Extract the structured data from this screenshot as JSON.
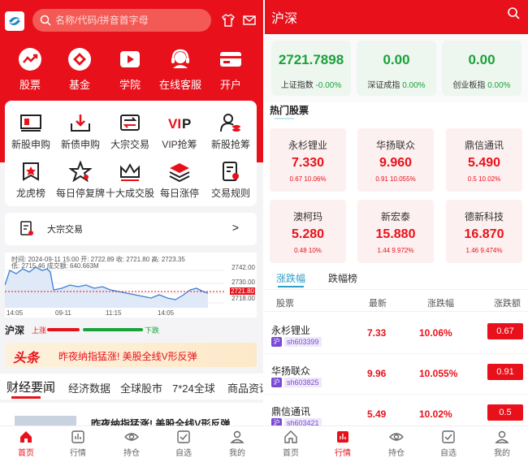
{
  "left": {
    "search": {
      "placeholder": "名称/代码/拼音首字母"
    },
    "quick": [
      {
        "label": "股票",
        "icon": "trend-icon"
      },
      {
        "label": "基金",
        "icon": "fund-icon"
      },
      {
        "label": "学院",
        "icon": "video-icon"
      },
      {
        "label": "在线客服",
        "icon": "headset-icon"
      },
      {
        "label": "开户",
        "icon": "card-icon"
      }
    ],
    "grid": [
      {
        "label": "新股申购",
        "icon": "ipo-icon"
      },
      {
        "label": "新债申购",
        "icon": "download-icon"
      },
      {
        "label": "大宗交易",
        "icon": "block-trade-icon"
      },
      {
        "label": "VIP抢筹",
        "icon": "vip-icon"
      },
      {
        "label": "新股抢筹",
        "icon": "user-coins-icon"
      },
      {
        "label": "龙虎榜",
        "icon": "badge-icon"
      },
      {
        "label": "每日停复牌",
        "icon": "star-icon"
      },
      {
        "label": "十大成交股",
        "icon": "crown-icon"
      },
      {
        "label": "每日涨停",
        "icon": "layers-icon"
      },
      {
        "label": "交易规则",
        "icon": "rules-icon"
      }
    ],
    "block_trade": {
      "label": "大宗交易",
      "arrow": ">"
    },
    "mini_chart": {
      "info": "时间: 2024-09-11 15:00   开: 2722.89   收: 2721.80   高: 2723.35",
      "info2": "低: 2715.46   成交额: 640.663M",
      "yticks": [
        "2742.00",
        "2730.00",
        "2721.80",
        "2718.00"
      ],
      "xticks": [
        "14:05",
        "09-11",
        "11:15",
        "14:05"
      ],
      "last": "2721.80"
    },
    "market": {
      "title": "沪深",
      "up": "上涨",
      "down": "下跌"
    },
    "banner": {
      "brand": "头条",
      "text": "昨夜纳指猛涨! 美股全线V形反弹"
    },
    "news_tabs": [
      "财经要闻",
      "经济数据",
      "全球股市",
      "7*24全球",
      "商品资讯"
    ],
    "news": {
      "title": "昨夜纳指猛涨! 美股全线V形反弹"
    },
    "nav": [
      {
        "label": "首页",
        "icon": "home-icon"
      },
      {
        "label": "行情",
        "icon": "market-icon"
      },
      {
        "label": "持仓",
        "icon": "position-icon"
      },
      {
        "label": "自选",
        "icon": "watchlist-icon"
      },
      {
        "label": "我的",
        "icon": "profile-icon"
      }
    ]
  },
  "right": {
    "title": "沪深",
    "indices": [
      {
        "value": "2721.7898",
        "name": "上证指数",
        "change": "-0.00%"
      },
      {
        "value": "0.00",
        "name": "深证成指",
        "change": "0.00%"
      },
      {
        "value": "0.00",
        "name": "创业板指",
        "change": "0.00%"
      }
    ],
    "hot_title": "热门股票",
    "hot": [
      {
        "name": "永杉锂业",
        "price": "7.330",
        "change": "0.67 10.06%"
      },
      {
        "name": "华扬联众",
        "price": "9.960",
        "change": "0.91 10.055%"
      },
      {
        "name": "鼎信通讯",
        "price": "5.490",
        "change": "0.5 10.02%"
      },
      {
        "name": "澳柯玛",
        "price": "5.280",
        "change": "0.48 10%"
      },
      {
        "name": "新宏泰",
        "price": "15.880",
        "change": "1.44 9.972%"
      },
      {
        "name": "德新科技",
        "price": "16.870",
        "change": "1.46 9.474%"
      }
    ],
    "tabs": [
      "涨跌幅",
      "跌幅榜"
    ],
    "table_head": [
      "股票",
      "最新",
      "涨跌幅",
      "涨跌额"
    ],
    "rows": [
      {
        "name": "永杉锂业",
        "market": "沪",
        "code": "sh603399",
        "price": "7.33",
        "pct": "10.06%",
        "amt": "0.67"
      },
      {
        "name": "华扬联众",
        "market": "沪",
        "code": "sh603825",
        "price": "9.96",
        "pct": "10.055%",
        "amt": "0.91"
      },
      {
        "name": "鼎信通讯",
        "market": "沪",
        "code": "sh603421",
        "price": "5.49",
        "pct": "10.02%",
        "amt": "0.5"
      }
    ],
    "nav": [
      {
        "label": "首页",
        "icon": "home-icon"
      },
      {
        "label": "行情",
        "icon": "market-icon"
      },
      {
        "label": "持仓",
        "icon": "position-icon"
      },
      {
        "label": "自选",
        "icon": "watchlist-icon"
      },
      {
        "label": "我的",
        "icon": "profile-icon"
      }
    ]
  },
  "colors": {
    "brand": "#e8111b",
    "green": "#1aa23a",
    "blue": "#2ea0c8"
  }
}
